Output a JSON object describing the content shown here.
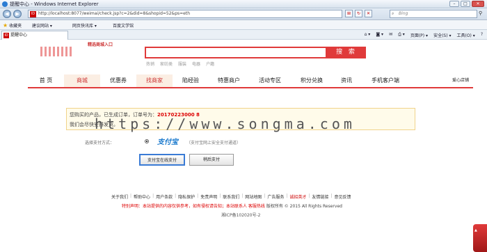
{
  "browser": {
    "title": "提醒中心 - Windows Internet Explorer",
    "address": "http://localhost:8077/weimai/check.jsp?c=2&did=8&shopid=52&ps=eth",
    "search_placeholder": "Bing",
    "favorites_label": "收藏夹",
    "favorites": [
      "建议网站 ▾",
      "网页快讯库 ▾",
      "百度文学馆"
    ],
    "tab_label": "提醒中心",
    "commands": [
      "页面(P) ▾",
      "安全(S) ▾",
      "工具(O) ▾",
      "?"
    ],
    "nav_back": "◀",
    "nav_forward": "▶"
  },
  "site": {
    "header_tag": "精选商城入口",
    "search_button": "搜 索",
    "hot_words": [
      "热销",
      "家纺类",
      "服装",
      "电器",
      "户籍"
    ]
  },
  "nav": {
    "items": [
      "首 页",
      "商城",
      "优惠券",
      "找商家",
      "陷经验",
      "特惠商户",
      "活动专区",
      "积分兑换",
      "资讯",
      "手机客户端",
      "爱心店铺"
    ]
  },
  "notice": {
    "line1_prefix": "您购买的产品，已生成订单，订单号为：",
    "order_no": "20170223000 8",
    "line2": "我们会尽快安排发货。"
  },
  "watermark": "https://www.songma.com",
  "payment": {
    "label": "选择支付方式：",
    "logo": "支付宝",
    "desc": "（支付宝网上安全支付通道）",
    "pay_button": "支付宝在线支付",
    "other_button": "稍后支付"
  },
  "footer": {
    "links": [
      "关于我们",
      "帮助中心",
      "用户条款",
      "隐私保护",
      "免责声明",
      "联系我们",
      "网站地图",
      "广告服务",
      "诚招英才",
      "友情链接",
      "意见反馈"
    ],
    "notice_red": "特别声明：本站提供的内容仅供参考，如有侵权请告知；本站联系人 客服热线",
    "notice_gray": "版权所有 © 2015 All Rights Reserved",
    "icp": "湘ICP备102020号-2"
  }
}
